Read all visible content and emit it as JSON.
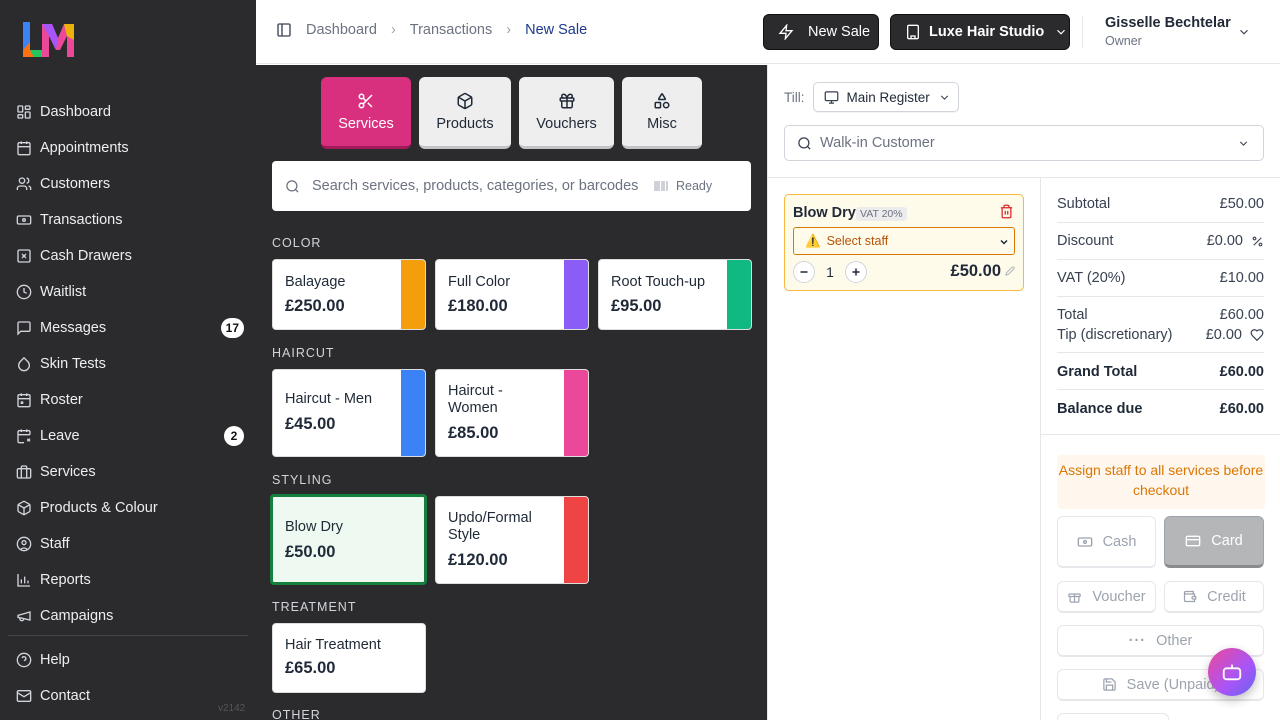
{
  "brand": {
    "logo_text": "LM"
  },
  "sidebar": {
    "items": [
      {
        "label": "Dashboard",
        "icon": "dashboard-icon"
      },
      {
        "label": "Appointments",
        "icon": "calendar-icon"
      },
      {
        "label": "Customers",
        "icon": "users-icon"
      },
      {
        "label": "Transactions",
        "icon": "banknote-icon"
      },
      {
        "label": "Cash Drawers",
        "icon": "cash-drawer-icon"
      },
      {
        "label": "Waitlist",
        "icon": "clock-icon"
      },
      {
        "label": "Messages",
        "icon": "message-icon",
        "badge": "17"
      },
      {
        "label": "Skin Tests",
        "icon": "droplet-icon"
      },
      {
        "label": "Roster",
        "icon": "calendar-check-icon"
      },
      {
        "label": "Leave",
        "icon": "leave-icon",
        "badge": "2"
      },
      {
        "label": "Services",
        "icon": "briefcase-icon"
      },
      {
        "label": "Products & Colour",
        "icon": "package-icon"
      },
      {
        "label": "Staff",
        "icon": "user-circle-icon"
      },
      {
        "label": "Reports",
        "icon": "bar-chart-icon"
      },
      {
        "label": "Campaigns",
        "icon": "megaphone-icon"
      }
    ],
    "bottom": [
      {
        "label": "Help",
        "icon": "help-icon"
      },
      {
        "label": "Contact",
        "icon": "mail-icon"
      }
    ],
    "version": "v2142"
  },
  "header": {
    "breadcrumb": [
      "Dashboard",
      "Transactions",
      "New Sale"
    ],
    "new_sale_label": "New Sale",
    "studio_label": "Luxe Hair Studio",
    "user_name": "Gisselle Bechtelar",
    "user_role": "Owner"
  },
  "pos": {
    "tabs": [
      {
        "label": "Services"
      },
      {
        "label": "Products"
      },
      {
        "label": "Vouchers"
      },
      {
        "label": "Misc"
      }
    ],
    "active_tab": "Services",
    "search_placeholder": "Search services, products, categories, or barcodes",
    "scanner_status": "Ready",
    "categories": [
      {
        "name": "COLOR",
        "services": [
          {
            "name": "Balayage",
            "price": "£250.00",
            "color": "#f59e0b"
          },
          {
            "name": "Full Color",
            "price": "£180.00",
            "color": "#8b5cf6"
          },
          {
            "name": "Root Touch-up",
            "price": "£95.00",
            "color": "#10b981"
          }
        ]
      },
      {
        "name": "HAIRCUT",
        "services": [
          {
            "name": "Haircut - Men",
            "price": "£45.00",
            "color": "#3b82f6"
          },
          {
            "name": "Haircut - Women",
            "price": "£85.00",
            "color": "#ec4899"
          }
        ]
      },
      {
        "name": "STYLING",
        "services": [
          {
            "name": "Blow Dry",
            "price": "£50.00",
            "selected": true
          },
          {
            "name": "Updo/Formal Style",
            "price": "£120.00",
            "color": "#ef4444"
          }
        ]
      },
      {
        "name": "TREATMENT",
        "services": [
          {
            "name": "Hair Treatment",
            "price": "£65.00"
          }
        ]
      },
      {
        "name": "OTHER",
        "services": []
      }
    ]
  },
  "cart": {
    "till_label": "Till:",
    "till_value": "Main Register",
    "customer_placeholder": "Walk-in Customer",
    "items": [
      {
        "name": "Blow Dry",
        "vat_badge": "VAT 20%",
        "staff_placeholder": "Select staff",
        "qty": "1",
        "price": "£50.00"
      }
    ]
  },
  "summary": {
    "subtotal_label": "Subtotal",
    "subtotal": "£50.00",
    "discount_label": "Discount",
    "discount": "£0.00",
    "vat_label": "VAT (20%)",
    "vat": "£10.00",
    "total_label": "Total",
    "total": "£60.00",
    "tip_label": "Tip (discretionary)",
    "tip": "£0.00",
    "grand_total_label": "Grand Total",
    "grand_total": "£60.00",
    "balance_label": "Balance due",
    "balance": "£60.00"
  },
  "checkout": {
    "warning": "Assign staff to all services before checkout",
    "buttons": {
      "cash": "Cash",
      "card": "Card",
      "voucher": "Voucher",
      "credit": "Credit",
      "other": "Other",
      "save": "Save (Unpaid)"
    }
  },
  "colors": {
    "accent": "#d8307f",
    "sidebar_bg": "#2b2b2d",
    "selected_border": "#15803d",
    "warning": "#d97706"
  }
}
